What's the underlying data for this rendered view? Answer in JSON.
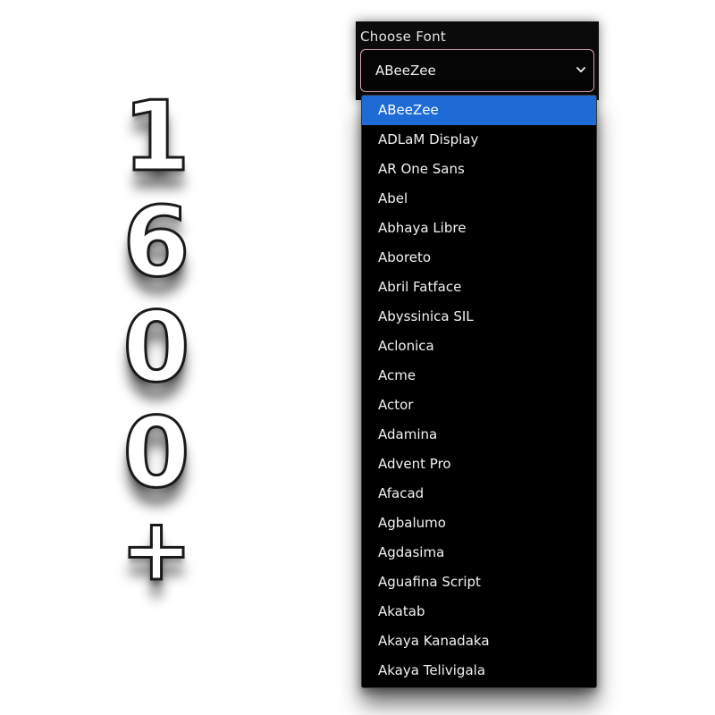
{
  "promo": {
    "chars": [
      "1",
      "6",
      "0",
      "0",
      "+"
    ]
  },
  "picker": {
    "label": "Choose Font",
    "selected_value": "ABeeZee",
    "chevron_icon": "chevron-down-icon",
    "accent_border": "#d9a0ad",
    "highlight_color": "#1e6bd6"
  },
  "dropdown": {
    "options": [
      "ABeeZee",
      "ADLaM Display",
      "AR One Sans",
      "Abel",
      "Abhaya Libre",
      "Aboreto",
      "Abril Fatface",
      "Abyssinica SIL",
      "Aclonica",
      "Acme",
      "Actor",
      "Adamina",
      "Advent Pro",
      "Afacad",
      "Agbalumo",
      "Agdasima",
      "Aguafina Script",
      "Akatab",
      "Akaya Kanadaka",
      "Akaya Telivigala"
    ],
    "selected_index": 0
  }
}
